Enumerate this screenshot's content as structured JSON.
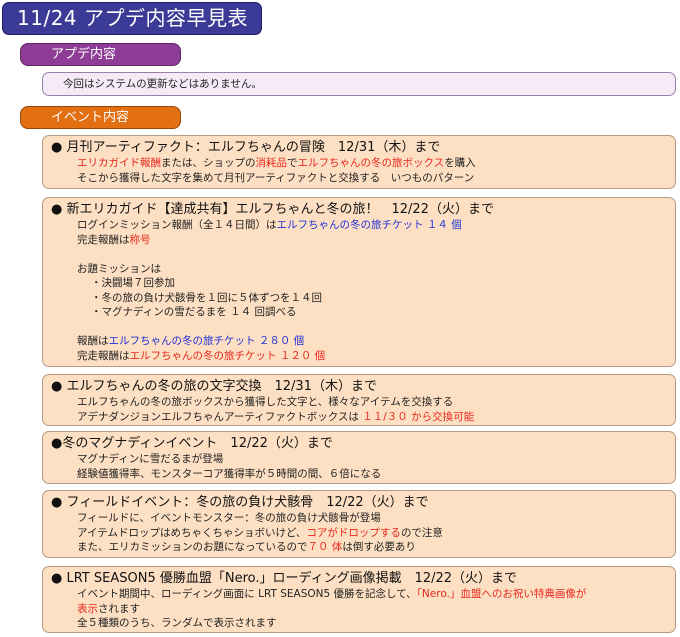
{
  "header": {
    "title": "11/24 アプデ内容早見表"
  },
  "sections": {
    "update": {
      "label": "アプデ内容",
      "text": "今回はシステムの更新などはありません。"
    },
    "event": {
      "label": "イベント内容"
    }
  },
  "colors": {
    "title_bg": "#3b3a96",
    "update_tab": "#8e3c95",
    "event_tab": "#e36f13",
    "event_box": "#fde0c4",
    "red_text": "#e8271c",
    "blue_text": "#1f2fd6"
  },
  "events": [
    {
      "title": "● 月刊アーティファクト：エルフちゃんの冒険　12/31（木）まで",
      "lines": [
        [
          {
            "t": "エリカガイド報酬",
            "c": "red"
          },
          {
            "t": "または、ショップの"
          },
          {
            "t": "消耗品",
            "c": "red"
          },
          {
            "t": "で"
          },
          {
            "t": "エルフちゃんの冬の旅ボックス",
            "c": "red"
          },
          {
            "t": "を購入"
          }
        ],
        [
          {
            "t": "そこから獲得した文字を集めて月刊アーティファクトと交換する　いつものパターン"
          }
        ]
      ]
    },
    {
      "title": "● 新エリカガイド【達成共有】エルフちゃんと冬の旅！　12/22（火）まで",
      "lines": [
        [
          {
            "t": "ログインミッション報酬（全１４日間）は"
          },
          {
            "t": "エルフちゃんの冬の旅チケット １４ 個",
            "c": "blue"
          }
        ],
        [
          {
            "t": "完走報酬は"
          },
          {
            "t": "称号",
            "c": "red"
          }
        ],
        [],
        [
          {
            "t": "お題ミッションは"
          }
        ],
        [
          {
            "t": "・決闘場７回参加",
            "ind": true
          }
        ],
        [
          {
            "t": "・冬の旅の負け犬骸骨を１回に５体ずつを１４回",
            "ind": true
          }
        ],
        [
          {
            "t": "・マグナディンの雪だるまを １４ 回調べる",
            "ind": true
          }
        ],
        [],
        [
          {
            "t": "報酬は"
          },
          {
            "t": "エルフちゃんの冬の旅チケット ２８０ 個",
            "c": "blue"
          }
        ],
        [
          {
            "t": "完走報酬は"
          },
          {
            "t": "エルフちゃんの冬の旅チケット １２０ 個",
            "c": "red"
          }
        ]
      ]
    },
    {
      "title": "● エルフちゃんの冬の旅の文字交換　12/31（木）まで",
      "lines": [
        [
          {
            "t": "エルフちゃんの冬の旅ボックスから獲得した文字と、様々なアイテムを交換する"
          }
        ],
        [
          {
            "t": "アデナダンジョンエルフちゃんアーティファクトボックスは "
          },
          {
            "t": "１１/３０ から交換可能",
            "c": "red"
          }
        ]
      ]
    },
    {
      "title": "●冬のマグナディンイベント　12/22（火）まで",
      "lines": [
        [
          {
            "t": "マグナディンに雪だるまが登場"
          }
        ],
        [
          {
            "t": "経験値獲得率、モンスターコア獲得率が５時間の間、６倍になる"
          }
        ]
      ]
    },
    {
      "title": "● フィールドイベント：冬の旅の負け犬骸骨　12/22（火）まで",
      "lines": [
        [
          {
            "t": "フィールドに、イベントモンスター：冬の旅の負け犬骸骨が登場"
          }
        ],
        [
          {
            "t": "アイテムドロップはめちゃくちゃショボいけど、"
          },
          {
            "t": "コアがドロップする",
            "c": "red"
          },
          {
            "t": "ので注意"
          }
        ],
        [
          {
            "t": "また、エリカミッションのお題になっているので"
          },
          {
            "t": "７０ 体",
            "c": "red"
          },
          {
            "t": "は倒す必要あり"
          }
        ]
      ]
    },
    {
      "title": "● LRT SEASON5 優勝血盟「Nero.」ローディング画像掲載　12/22（火）まで",
      "lines": [
        [
          {
            "t": "イベント期間中、ローディング画面に LRT SEASON5 優勝を記念して、"
          },
          {
            "t": "「Nero.」血盟へのお祝い特典画像が",
            "c": "red"
          }
        ],
        [
          {
            "t": "表示",
            "c": "red"
          },
          {
            "t": "されます"
          }
        ],
        [
          {
            "t": "全５種類のうち、ランダムで表示されます"
          }
        ]
      ]
    }
  ]
}
